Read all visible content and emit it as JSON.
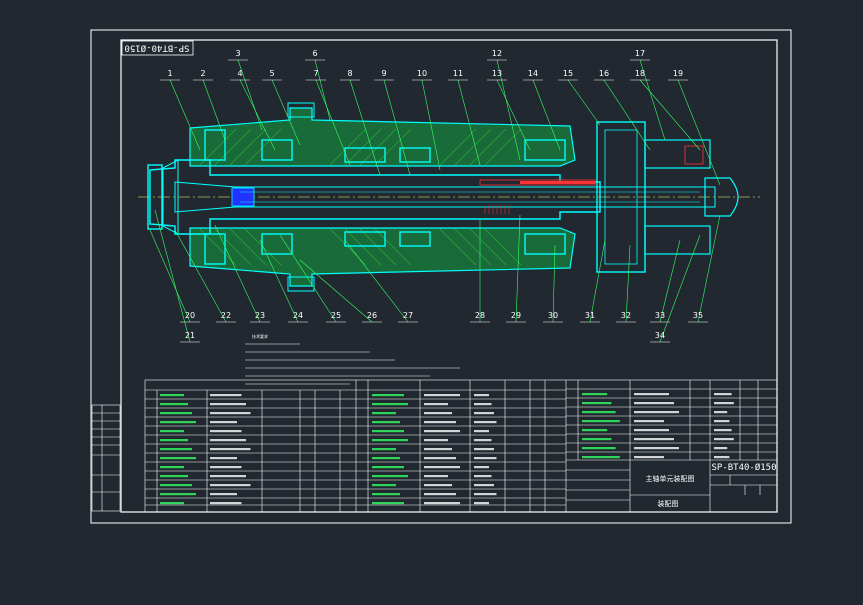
{
  "drawing_code": "SP-BT40-Ø150",
  "drawing_code_rotated": "SP-BT40-Ø150",
  "balloons_top": [
    "1",
    "2",
    "3",
    "4",
    "5",
    "6",
    "7",
    "8",
    "9",
    "10",
    "11",
    "12",
    "13",
    "14",
    "15",
    "16",
    "17",
    "18",
    "19"
  ],
  "balloons_bottom": [
    "20",
    "21",
    "22",
    "23",
    "24",
    "25",
    "26",
    "27",
    "28",
    "29",
    "30",
    "31",
    "32",
    "33",
    "34",
    "35"
  ],
  "notes_title": "技术要求",
  "title_block": {
    "drawing_name": "主轴单元装配图",
    "drawing_type": "装配图",
    "code": "SP-BT40-Ø150"
  },
  "colors": {
    "background": "#212830",
    "frame": "#ffffff",
    "part": "#00ffff",
    "hatch": "#33dd33",
    "leader": "#33ff66",
    "accent": "#ff3333"
  }
}
